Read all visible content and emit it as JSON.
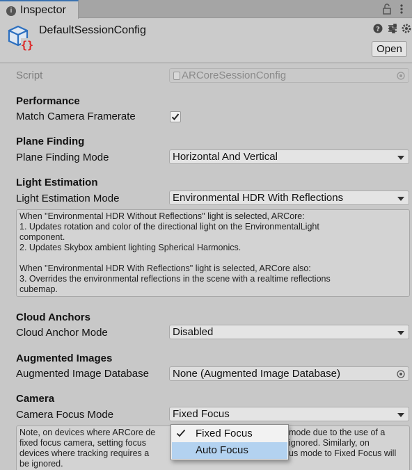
{
  "window": {
    "tab_label": "Inspector",
    "tab_icon": "info-icon"
  },
  "header": {
    "asset_name": "DefaultSessionConfig",
    "open_label": "Open",
    "icons": [
      "help-icon",
      "settings-sliders-icon",
      "gear-icon"
    ]
  },
  "script": {
    "label": "Script",
    "value": "ARCoreSessionConfig"
  },
  "performance": {
    "title": "Performance",
    "match_label": "Match Camera Framerate",
    "match_checked": true
  },
  "plane": {
    "title": "Plane Finding",
    "mode_label": "Plane Finding Mode",
    "mode_value": "Horizontal And Vertical"
  },
  "light": {
    "title": "Light Estimation",
    "mode_label": "Light Estimation Mode",
    "mode_value": "Environmental HDR With Reflections",
    "help": [
      "When \"Environmental HDR Without Reflections\" light is selected, ARCore:",
      "1. Updates rotation and color of the directional light on the EnvironmentalLight",
      "component.",
      "2. Updates Skybox ambient lighting Spherical Harmonics.",
      "",
      "When \"Environmental HDR With Reflections\" light is selected, ARCore also:",
      "3. Overrides the environmental reflections in the scene with a realtime reflections",
      "cubemap."
    ]
  },
  "cloud": {
    "title": "Cloud Anchors",
    "mode_label": "Cloud Anchor Mode",
    "mode_value": "Disabled"
  },
  "images": {
    "title": "Augmented Images",
    "db_label": "Augmented Image Database",
    "db_value": "None (Augmented Image Database)"
  },
  "camera": {
    "title": "Camera",
    "focus_label": "Camera Focus Mode",
    "focus_value": "Fixed Focus",
    "help": [
      "Note, on devices where ARCore de",
      "fixed focus camera, setting focus",
      "devices where tracking requires a",
      "be ignored."
    ],
    "help_right": [
      " mode due to the use of a",
      " ignored. Similarly, on",
      "us mode to Fixed Focus will",
      ""
    ],
    "options": [
      {
        "label": "Fixed Focus",
        "checked": true,
        "highlighted": false
      },
      {
        "label": "Auto Focus",
        "checked": false,
        "highlighted": true
      }
    ]
  }
}
